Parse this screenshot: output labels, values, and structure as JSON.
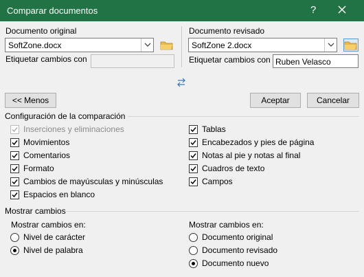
{
  "window": {
    "title": "Comparar documentos",
    "help": "?",
    "close_icon": "close-icon"
  },
  "original": {
    "label": "Documento original",
    "file": "SoftZone.docx",
    "tag_label": "Etiquetar cambios con",
    "tag_value": ""
  },
  "revised": {
    "label": "Documento revisado",
    "file": "SoftZone 2.docx",
    "tag_label": "Etiquetar cambios con",
    "tag_value": "Ruben Velasco"
  },
  "swap_icon": "swap-arrows-icon",
  "buttons": {
    "less": "<< Menos",
    "accept": "Aceptar",
    "cancel": "Cancelar"
  },
  "comparison": {
    "title": "Configuración de la comparación",
    "left": [
      {
        "label": "Inserciones y eliminaciones",
        "checked": true,
        "disabled": true
      },
      {
        "label": "Movimientos",
        "checked": true,
        "disabled": false
      },
      {
        "label": "Comentarios",
        "checked": true,
        "disabled": false
      },
      {
        "label": "Formato",
        "checked": true,
        "disabled": false
      },
      {
        "label": "Cambios de mayúsculas y minúsculas",
        "checked": true,
        "disabled": false
      },
      {
        "label": "Espacios en blanco",
        "checked": true,
        "disabled": false
      }
    ],
    "right": [
      {
        "label": "Tablas",
        "checked": true
      },
      {
        "label": "Encabezados y pies de página",
        "checked": true
      },
      {
        "label": "Notas al pie y notas al final",
        "checked": true
      },
      {
        "label": "Cuadros de texto",
        "checked": true
      },
      {
        "label": "Campos",
        "checked": true
      }
    ]
  },
  "show": {
    "title": "Mostrar cambios",
    "level_label": "Mostrar cambios en:",
    "level_options": [
      {
        "label": "Nivel de carácter",
        "selected": false
      },
      {
        "label": "Nivel de palabra",
        "selected": true
      }
    ],
    "doc_label": "Mostrar cambios en:",
    "doc_options": [
      {
        "label": "Documento original",
        "selected": false
      },
      {
        "label": "Documento revisado",
        "selected": false
      },
      {
        "label": "Documento nuevo",
        "selected": true
      }
    ]
  },
  "colors": {
    "titlebar": "#217346",
    "dialog_bg": "#f0f0f0",
    "button_bg": "#e1e1e1"
  }
}
